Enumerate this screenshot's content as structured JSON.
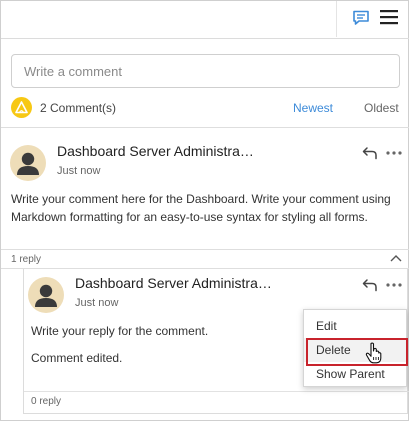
{
  "input": {
    "placeholder": "Write a comment"
  },
  "summary": {
    "count_label": "2 Comment(s)",
    "sort_newest": "Newest",
    "sort_oldest": "Oldest"
  },
  "comment": {
    "author": "Dashboard Server Administra…",
    "time": "Just now",
    "body": "Write your comment here for the Dashboard. Write your comment using Markdown formatting for an easy-to-use syntax for styling all forms.",
    "reply_count": "1 reply"
  },
  "reply": {
    "author": "Dashboard Server Administra…",
    "time": "Just now",
    "body_line1": "Write your reply for the comment.",
    "body_line2": "Comment edited.",
    "reply_count": "0 reply"
  },
  "context_menu": {
    "items": [
      "Edit",
      "Delete",
      "Show Parent"
    ]
  },
  "colors": {
    "accent": "#3d8bd9",
    "badge": "#f7c814",
    "highlight": "#c8232c",
    "avatar_bg": "#eeddb8",
    "avatar_fg": "#3a3a3a"
  },
  "icons": [
    "comment-icon",
    "hamburger-menu-icon",
    "alert-icon",
    "reply-icon",
    "more-icon",
    "chevron-up-icon",
    "hand-cursor-icon",
    "user-icon"
  ]
}
